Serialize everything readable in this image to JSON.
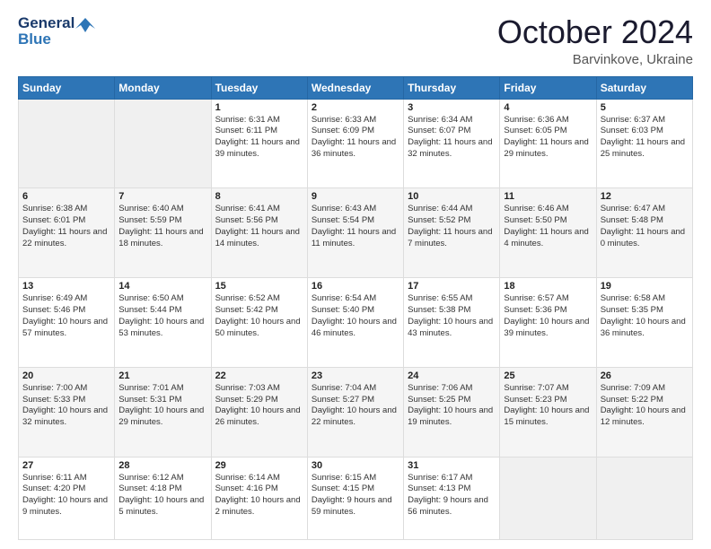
{
  "header": {
    "logo_line1": "General",
    "logo_line2": "Blue",
    "month": "October 2024",
    "location": "Barvinkove, Ukraine"
  },
  "weekdays": [
    "Sunday",
    "Monday",
    "Tuesday",
    "Wednesday",
    "Thursday",
    "Friday",
    "Saturday"
  ],
  "weeks": [
    [
      {
        "day": "",
        "info": ""
      },
      {
        "day": "",
        "info": ""
      },
      {
        "day": "1",
        "info": "Sunrise: 6:31 AM\nSunset: 6:11 PM\nDaylight: 11 hours and 39 minutes."
      },
      {
        "day": "2",
        "info": "Sunrise: 6:33 AM\nSunset: 6:09 PM\nDaylight: 11 hours and 36 minutes."
      },
      {
        "day": "3",
        "info": "Sunrise: 6:34 AM\nSunset: 6:07 PM\nDaylight: 11 hours and 32 minutes."
      },
      {
        "day": "4",
        "info": "Sunrise: 6:36 AM\nSunset: 6:05 PM\nDaylight: 11 hours and 29 minutes."
      },
      {
        "day": "5",
        "info": "Sunrise: 6:37 AM\nSunset: 6:03 PM\nDaylight: 11 hours and 25 minutes."
      }
    ],
    [
      {
        "day": "6",
        "info": "Sunrise: 6:38 AM\nSunset: 6:01 PM\nDaylight: 11 hours and 22 minutes."
      },
      {
        "day": "7",
        "info": "Sunrise: 6:40 AM\nSunset: 5:59 PM\nDaylight: 11 hours and 18 minutes."
      },
      {
        "day": "8",
        "info": "Sunrise: 6:41 AM\nSunset: 5:56 PM\nDaylight: 11 hours and 14 minutes."
      },
      {
        "day": "9",
        "info": "Sunrise: 6:43 AM\nSunset: 5:54 PM\nDaylight: 11 hours and 11 minutes."
      },
      {
        "day": "10",
        "info": "Sunrise: 6:44 AM\nSunset: 5:52 PM\nDaylight: 11 hours and 7 minutes."
      },
      {
        "day": "11",
        "info": "Sunrise: 6:46 AM\nSunset: 5:50 PM\nDaylight: 11 hours and 4 minutes."
      },
      {
        "day": "12",
        "info": "Sunrise: 6:47 AM\nSunset: 5:48 PM\nDaylight: 11 hours and 0 minutes."
      }
    ],
    [
      {
        "day": "13",
        "info": "Sunrise: 6:49 AM\nSunset: 5:46 PM\nDaylight: 10 hours and 57 minutes."
      },
      {
        "day": "14",
        "info": "Sunrise: 6:50 AM\nSunset: 5:44 PM\nDaylight: 10 hours and 53 minutes."
      },
      {
        "day": "15",
        "info": "Sunrise: 6:52 AM\nSunset: 5:42 PM\nDaylight: 10 hours and 50 minutes."
      },
      {
        "day": "16",
        "info": "Sunrise: 6:54 AM\nSunset: 5:40 PM\nDaylight: 10 hours and 46 minutes."
      },
      {
        "day": "17",
        "info": "Sunrise: 6:55 AM\nSunset: 5:38 PM\nDaylight: 10 hours and 43 minutes."
      },
      {
        "day": "18",
        "info": "Sunrise: 6:57 AM\nSunset: 5:36 PM\nDaylight: 10 hours and 39 minutes."
      },
      {
        "day": "19",
        "info": "Sunrise: 6:58 AM\nSunset: 5:35 PM\nDaylight: 10 hours and 36 minutes."
      }
    ],
    [
      {
        "day": "20",
        "info": "Sunrise: 7:00 AM\nSunset: 5:33 PM\nDaylight: 10 hours and 32 minutes."
      },
      {
        "day": "21",
        "info": "Sunrise: 7:01 AM\nSunset: 5:31 PM\nDaylight: 10 hours and 29 minutes."
      },
      {
        "day": "22",
        "info": "Sunrise: 7:03 AM\nSunset: 5:29 PM\nDaylight: 10 hours and 26 minutes."
      },
      {
        "day": "23",
        "info": "Sunrise: 7:04 AM\nSunset: 5:27 PM\nDaylight: 10 hours and 22 minutes."
      },
      {
        "day": "24",
        "info": "Sunrise: 7:06 AM\nSunset: 5:25 PM\nDaylight: 10 hours and 19 minutes."
      },
      {
        "day": "25",
        "info": "Sunrise: 7:07 AM\nSunset: 5:23 PM\nDaylight: 10 hours and 15 minutes."
      },
      {
        "day": "26",
        "info": "Sunrise: 7:09 AM\nSunset: 5:22 PM\nDaylight: 10 hours and 12 minutes."
      }
    ],
    [
      {
        "day": "27",
        "info": "Sunrise: 6:11 AM\nSunset: 4:20 PM\nDaylight: 10 hours and 9 minutes."
      },
      {
        "day": "28",
        "info": "Sunrise: 6:12 AM\nSunset: 4:18 PM\nDaylight: 10 hours and 5 minutes."
      },
      {
        "day": "29",
        "info": "Sunrise: 6:14 AM\nSunset: 4:16 PM\nDaylight: 10 hours and 2 minutes."
      },
      {
        "day": "30",
        "info": "Sunrise: 6:15 AM\nSunset: 4:15 PM\nDaylight: 9 hours and 59 minutes."
      },
      {
        "day": "31",
        "info": "Sunrise: 6:17 AM\nSunset: 4:13 PM\nDaylight: 9 hours and 56 minutes."
      },
      {
        "day": "",
        "info": ""
      },
      {
        "day": "",
        "info": ""
      }
    ]
  ]
}
